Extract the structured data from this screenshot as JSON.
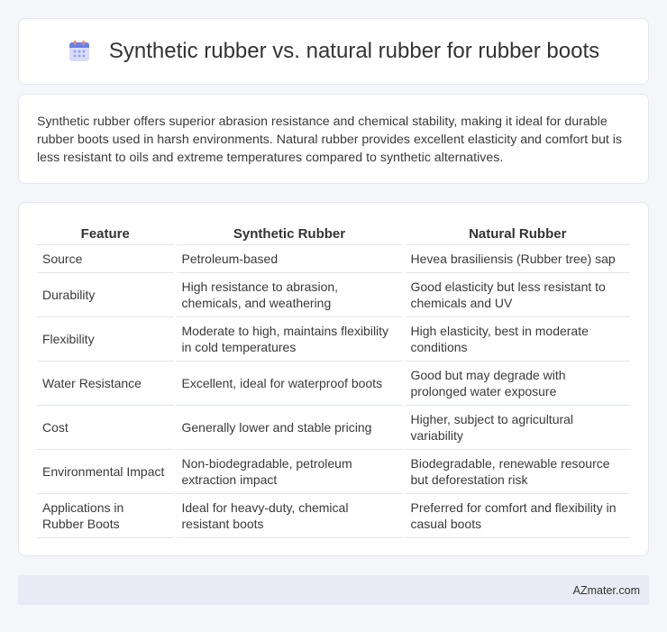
{
  "header": {
    "title": "Synthetic rubber vs. natural rubber for rubber boots",
    "icon": "calendar-icon"
  },
  "summary": {
    "text": "Synthetic rubber offers superior abrasion resistance and chemical stability, making it ideal for durable rubber boots used in harsh environments. Natural rubber provides excellent elasticity and comfort but is less resistant to oils and extreme temperatures compared to synthetic alternatives."
  },
  "table": {
    "headers": [
      "Feature",
      "Synthetic Rubber",
      "Natural Rubber"
    ],
    "rows": [
      [
        "Source",
        "Petroleum-based",
        "Hevea brasiliensis (Rubber tree) sap"
      ],
      [
        "Durability",
        "High resistance to abrasion, chemicals, and weathering",
        "Good elasticity but less resistant to chemicals and UV"
      ],
      [
        "Flexibility",
        "Moderate to high, maintains flexibility in cold temperatures",
        "High elasticity, best in moderate conditions"
      ],
      [
        "Water Resistance",
        "Excellent, ideal for waterproof boots",
        "Good but may degrade with prolonged water exposure"
      ],
      [
        "Cost",
        "Generally lower and stable pricing",
        "Higher, subject to agricultural variability"
      ],
      [
        "Environmental Impact",
        "Non-biodegradable, petroleum extraction impact",
        "Biodegradable, renewable resource but deforestation risk"
      ],
      [
        "Applications in Rubber Boots",
        "Ideal for heavy-duty, chemical resistant boots",
        "Preferred for comfort and flexibility in casual boots"
      ]
    ]
  },
  "footer": {
    "brand": "AZmater.com"
  }
}
